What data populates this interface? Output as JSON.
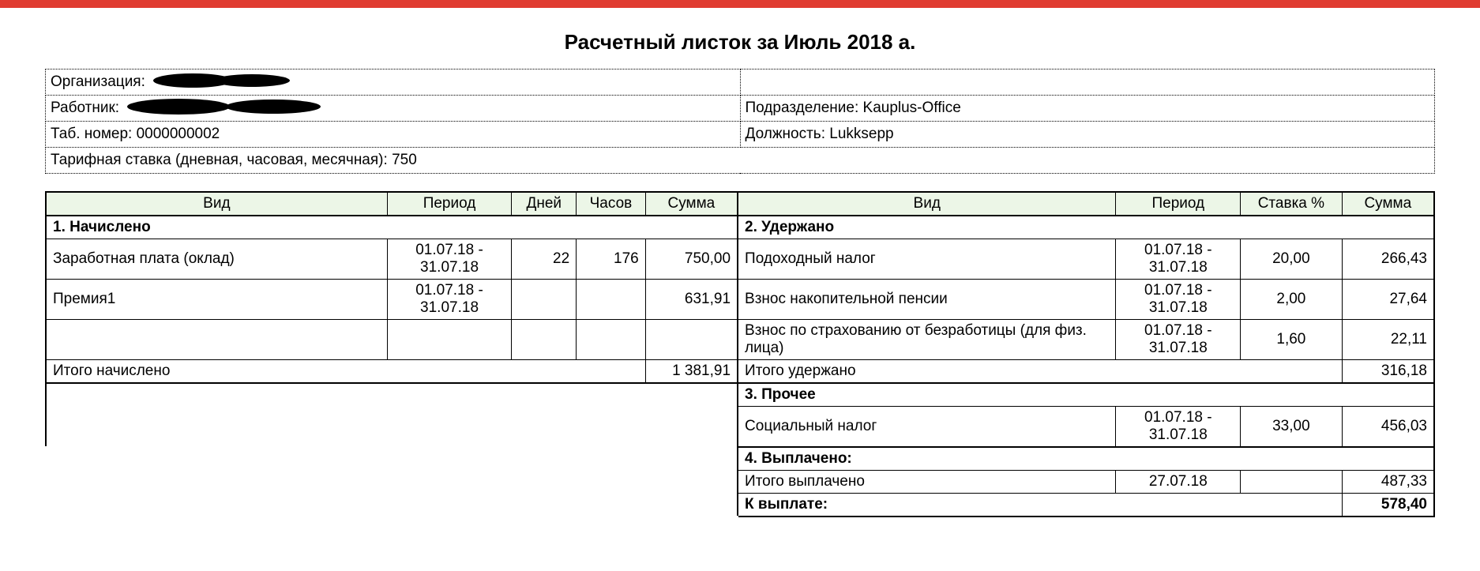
{
  "title": "Расчетный листок за Июль 2018 а.",
  "info": {
    "org_label": "Организация:",
    "org_value": "",
    "worker_label": "Работник:",
    "worker_value": "",
    "dept_label": "Подразделение:",
    "dept_value": "Kauplus-Office",
    "tab_label": "Таб. номер:",
    "tab_value": "0000000002",
    "pos_label": "Должность:",
    "pos_value": "Lukksepp",
    "rate_label": "Тарифная ставка (дневная, часовая, месячная):",
    "rate_value": "750"
  },
  "headers": {
    "vid": "Вид",
    "period": "Период",
    "days": "Дней",
    "hours": "Часов",
    "sum": "Сумма",
    "rate": "Ставка %"
  },
  "sections": {
    "accrued": "1. Начислено",
    "withheld": "2. Удержано",
    "other": "3. Прочее",
    "paid": "4. Выплачено:"
  },
  "accrued": {
    "rows": [
      {
        "name": "Заработная плата (оклад)",
        "period": "01.07.18 - 31.07.18",
        "days": "22",
        "hours": "176",
        "sum": "750,00"
      },
      {
        "name": "Премия1",
        "period": "01.07.18 - 31.07.18",
        "days": "",
        "hours": "",
        "sum": "631,91"
      },
      {
        "name": "",
        "period": "",
        "days": "",
        "hours": "",
        "sum": ""
      }
    ],
    "total_label": "Итого начислено",
    "total_value": "1 381,91"
  },
  "withheld": {
    "rows": [
      {
        "name": "Подоходный налог",
        "period": "01.07.18 - 31.07.18",
        "rate": "20,00",
        "sum": "266,43"
      },
      {
        "name": "Взнос накопительной пенсии",
        "period": "01.07.18 - 31.07.18",
        "rate": "2,00",
        "sum": "27,64"
      },
      {
        "name": "Взнос по страхованию от безработицы (для физ. лица)",
        "period": "01.07.18 - 31.07.18",
        "rate": "1,60",
        "sum": "22,11"
      }
    ],
    "total_label": "Итого удержано",
    "total_value": "316,18"
  },
  "other": {
    "rows": [
      {
        "name": "Социальный налог",
        "period": "01.07.18 - 31.07.18",
        "rate": "33,00",
        "sum": "456,03"
      }
    ]
  },
  "paid": {
    "total_label": "Итого выплачено",
    "date": "27.07.18",
    "total_value": "487,33",
    "topay_label": "К выплате:",
    "topay_value": "578,40"
  }
}
